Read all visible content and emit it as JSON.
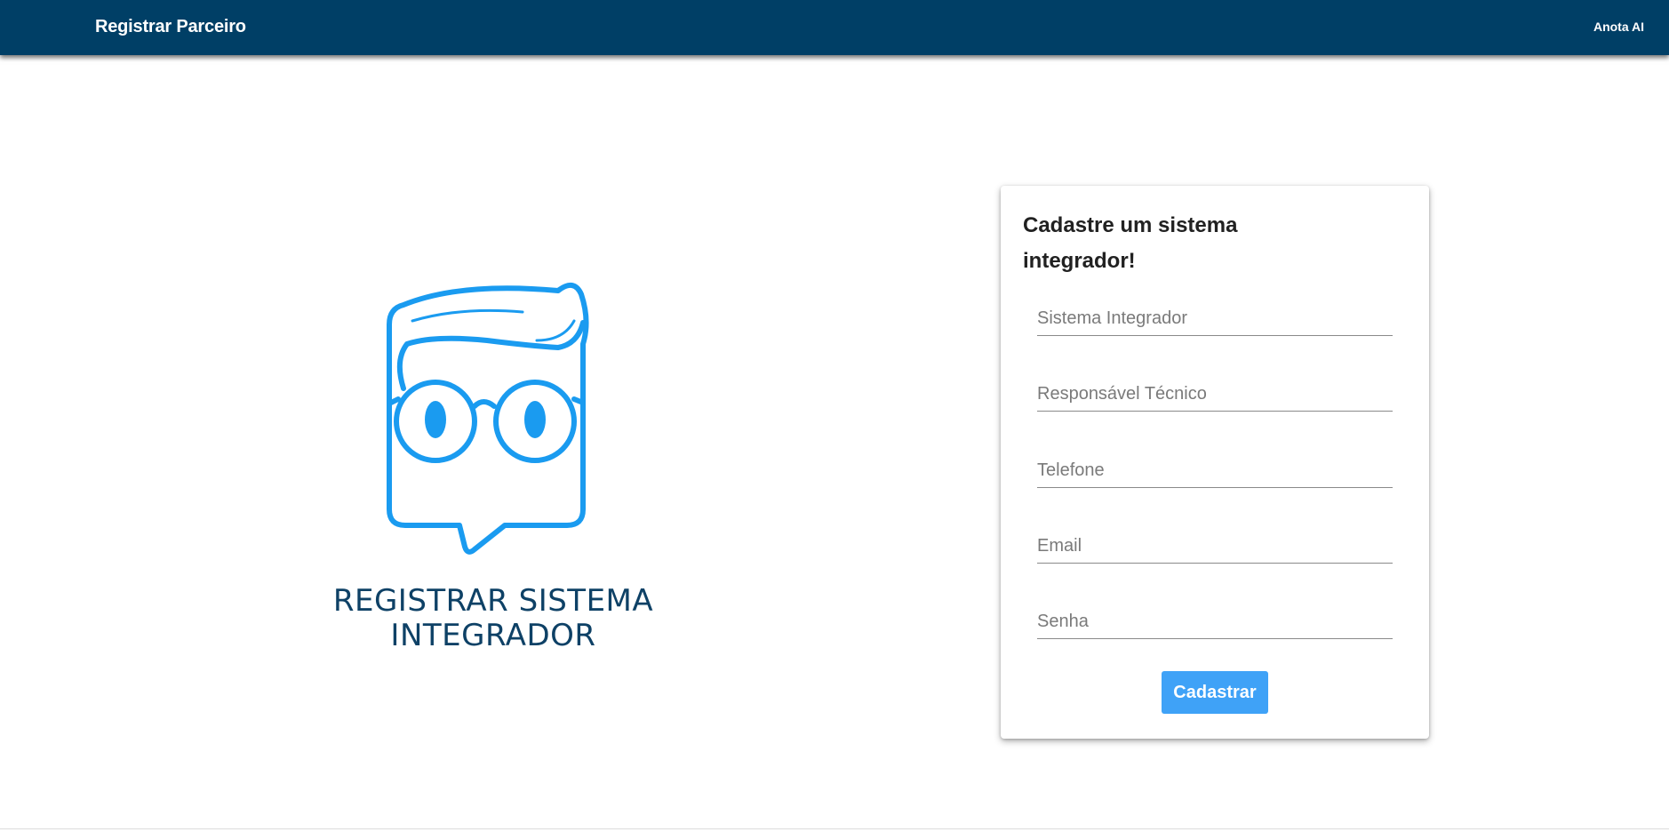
{
  "header": {
    "title": "Registrar Parceiro",
    "link_label": "Anota AI"
  },
  "logo": {
    "icon": "owl-glasses-chat-bubble-icon",
    "caption_line1": "REGISTRAR SISTEMA",
    "caption_line2": "INTEGRADOR"
  },
  "form": {
    "title": "Cadastre um sistema integrador!",
    "fields": [
      {
        "placeholder": "Sistema Integrador",
        "value": ""
      },
      {
        "placeholder": "Responsável Técnico",
        "value": ""
      },
      {
        "placeholder": "Telefone",
        "value": ""
      },
      {
        "placeholder": "Email",
        "value": ""
      },
      {
        "placeholder": "Senha",
        "value": ""
      }
    ],
    "submit_label": "Cadastrar"
  },
  "colors": {
    "header_bg": "#003f66",
    "logo_blue": "#1a9bf0",
    "caption_blue": "#0e4166",
    "button_bg": "#3fa2f7"
  }
}
